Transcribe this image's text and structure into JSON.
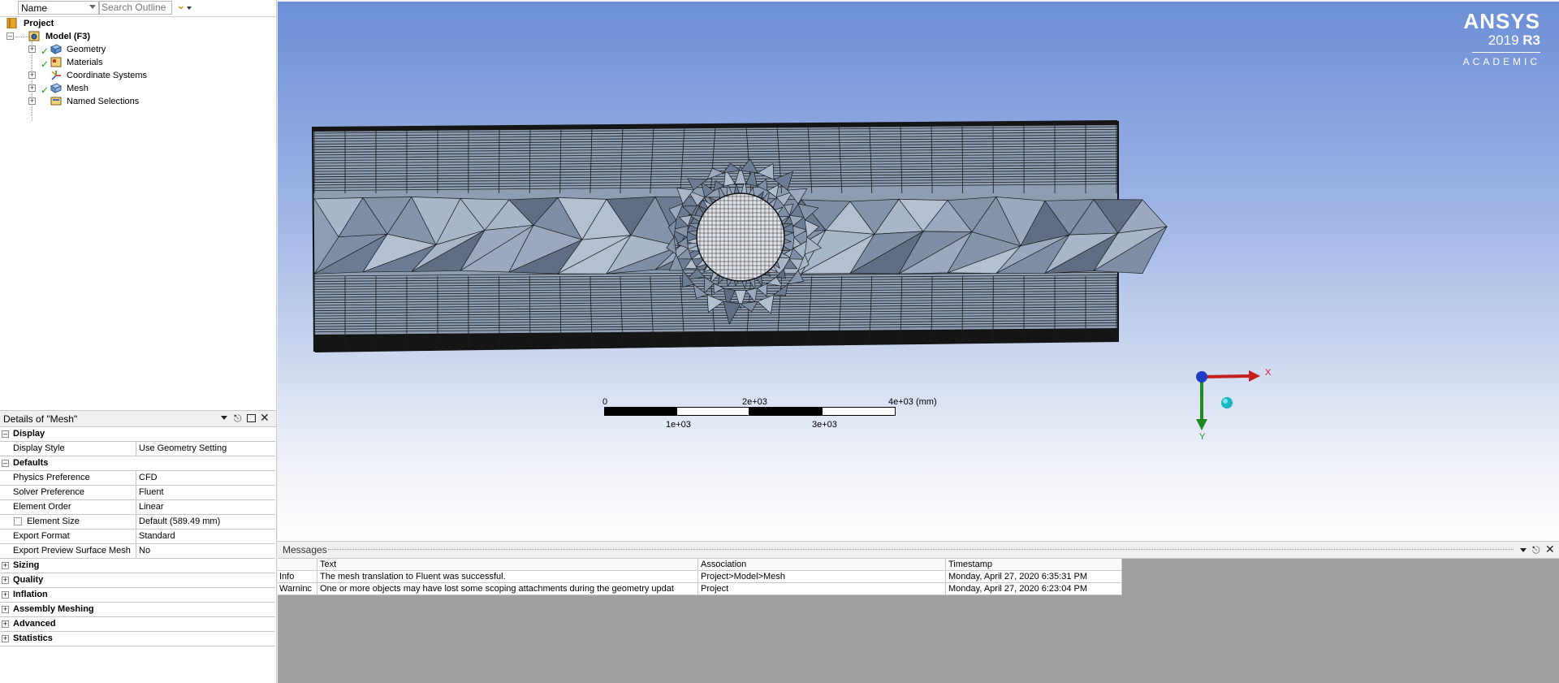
{
  "outline": {
    "name_filter": "Name",
    "search_placeholder": "Search Outline",
    "tree": {
      "project": "Project",
      "model": "Model (F3)",
      "children": [
        "Geometry",
        "Materials",
        "Coordinate Systems",
        "Mesh",
        "Named Selections"
      ]
    }
  },
  "details": {
    "title": "Details of \"Mesh\"",
    "groups": {
      "display": "Display",
      "defaults": "Defaults",
      "sizing": "Sizing",
      "quality": "Quality",
      "inflation": "Inflation",
      "assembly_meshing": "Assembly Meshing",
      "advanced": "Advanced",
      "statistics": "Statistics"
    },
    "rows": {
      "display_style": {
        "key": "Display Style",
        "value": "Use Geometry Setting"
      },
      "physics_preference": {
        "key": "Physics Preference",
        "value": "CFD"
      },
      "solver_preference": {
        "key": "Solver Preference",
        "value": "Fluent"
      },
      "element_order": {
        "key": "Element Order",
        "value": "Linear"
      },
      "element_size": {
        "key": "Element Size",
        "value": "Default (589.49 mm)"
      },
      "export_format": {
        "key": "Export Format",
        "value": "Standard"
      },
      "export_preview": {
        "key": "Export Preview Surface Mesh",
        "value": "No"
      }
    }
  },
  "viewport": {
    "logo": {
      "brand": "ANSYS",
      "year": "2019",
      "release": "R3",
      "edition": "ACADEMIC"
    },
    "scale_bar": {
      "labels_top": [
        "0",
        "2e+03",
        "4e+03 (mm)"
      ],
      "labels_bottom": [
        "1e+03",
        "3e+03"
      ]
    },
    "triad": {
      "x_label": "X",
      "y_label": "Y"
    }
  },
  "messages": {
    "title": "Messages",
    "columns": [
      "Text",
      "Association",
      "Timestamp"
    ],
    "rows": [
      {
        "type": "Info",
        "text": "The mesh translation to Fluent was successful.",
        "association": "Project>Model>Mesh",
        "timestamp": "Monday, April 27, 2020 6:35:31 PM"
      },
      {
        "type": "Warninc",
        "text": "One or more objects may have lost some scoping attachments during the geometry updat",
        "association": "Project",
        "timestamp": "Monday, April 27, 2020 6:23:04 PM"
      }
    ]
  },
  "colors": {
    "viewport_top": "#6b8ed6",
    "viewport_bottom": "#ffffff",
    "mesh_face": "#8f9fb5",
    "mesh_edge": "#1c1c1c",
    "triad_x": "#c81e1e",
    "triad_y": "#1f8a1f",
    "triad_z": "#1e3cc8"
  }
}
